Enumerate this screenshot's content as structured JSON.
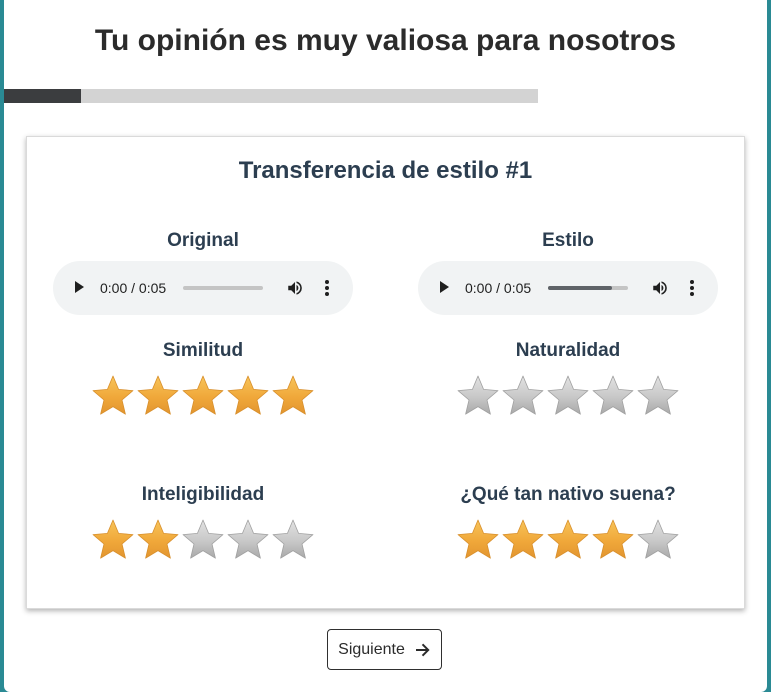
{
  "page": {
    "title": "Tu opinión es muy valiosa para nosotros"
  },
  "progress": {
    "fraction": 0.145
  },
  "card": {
    "title": "Transferencia de estilo #1",
    "original": {
      "label": "Original",
      "player": {
        "time": "0:00 / 0:05",
        "seek_fraction": 0.0,
        "play_icon": "play-icon",
        "volume_icon": "volume-icon",
        "menu_icon": "more-vert-icon"
      }
    },
    "style": {
      "label": "Estilo",
      "player": {
        "time": "0:00 / 0:05",
        "seek_fraction": 0.8,
        "play_icon": "play-icon",
        "volume_icon": "volume-icon",
        "menu_icon": "more-vert-icon"
      }
    },
    "ratings": [
      {
        "label": "Similitud",
        "value": 5,
        "max": 5
      },
      {
        "label": "Naturalidad",
        "value": 0,
        "max": 5
      },
      {
        "label": "Inteligibilidad",
        "value": 2,
        "max": 5
      },
      {
        "label": "¿Qué tan nativo suena?",
        "value": 4,
        "max": 5
      }
    ]
  },
  "next_button": {
    "label": "Siguiente",
    "icon": "arrow-right-icon"
  },
  "colors": {
    "star_filled": "#f0a83a",
    "star_empty": "#c8c8c8",
    "background": "#2a8a94",
    "title_text": "#2c3e50"
  }
}
